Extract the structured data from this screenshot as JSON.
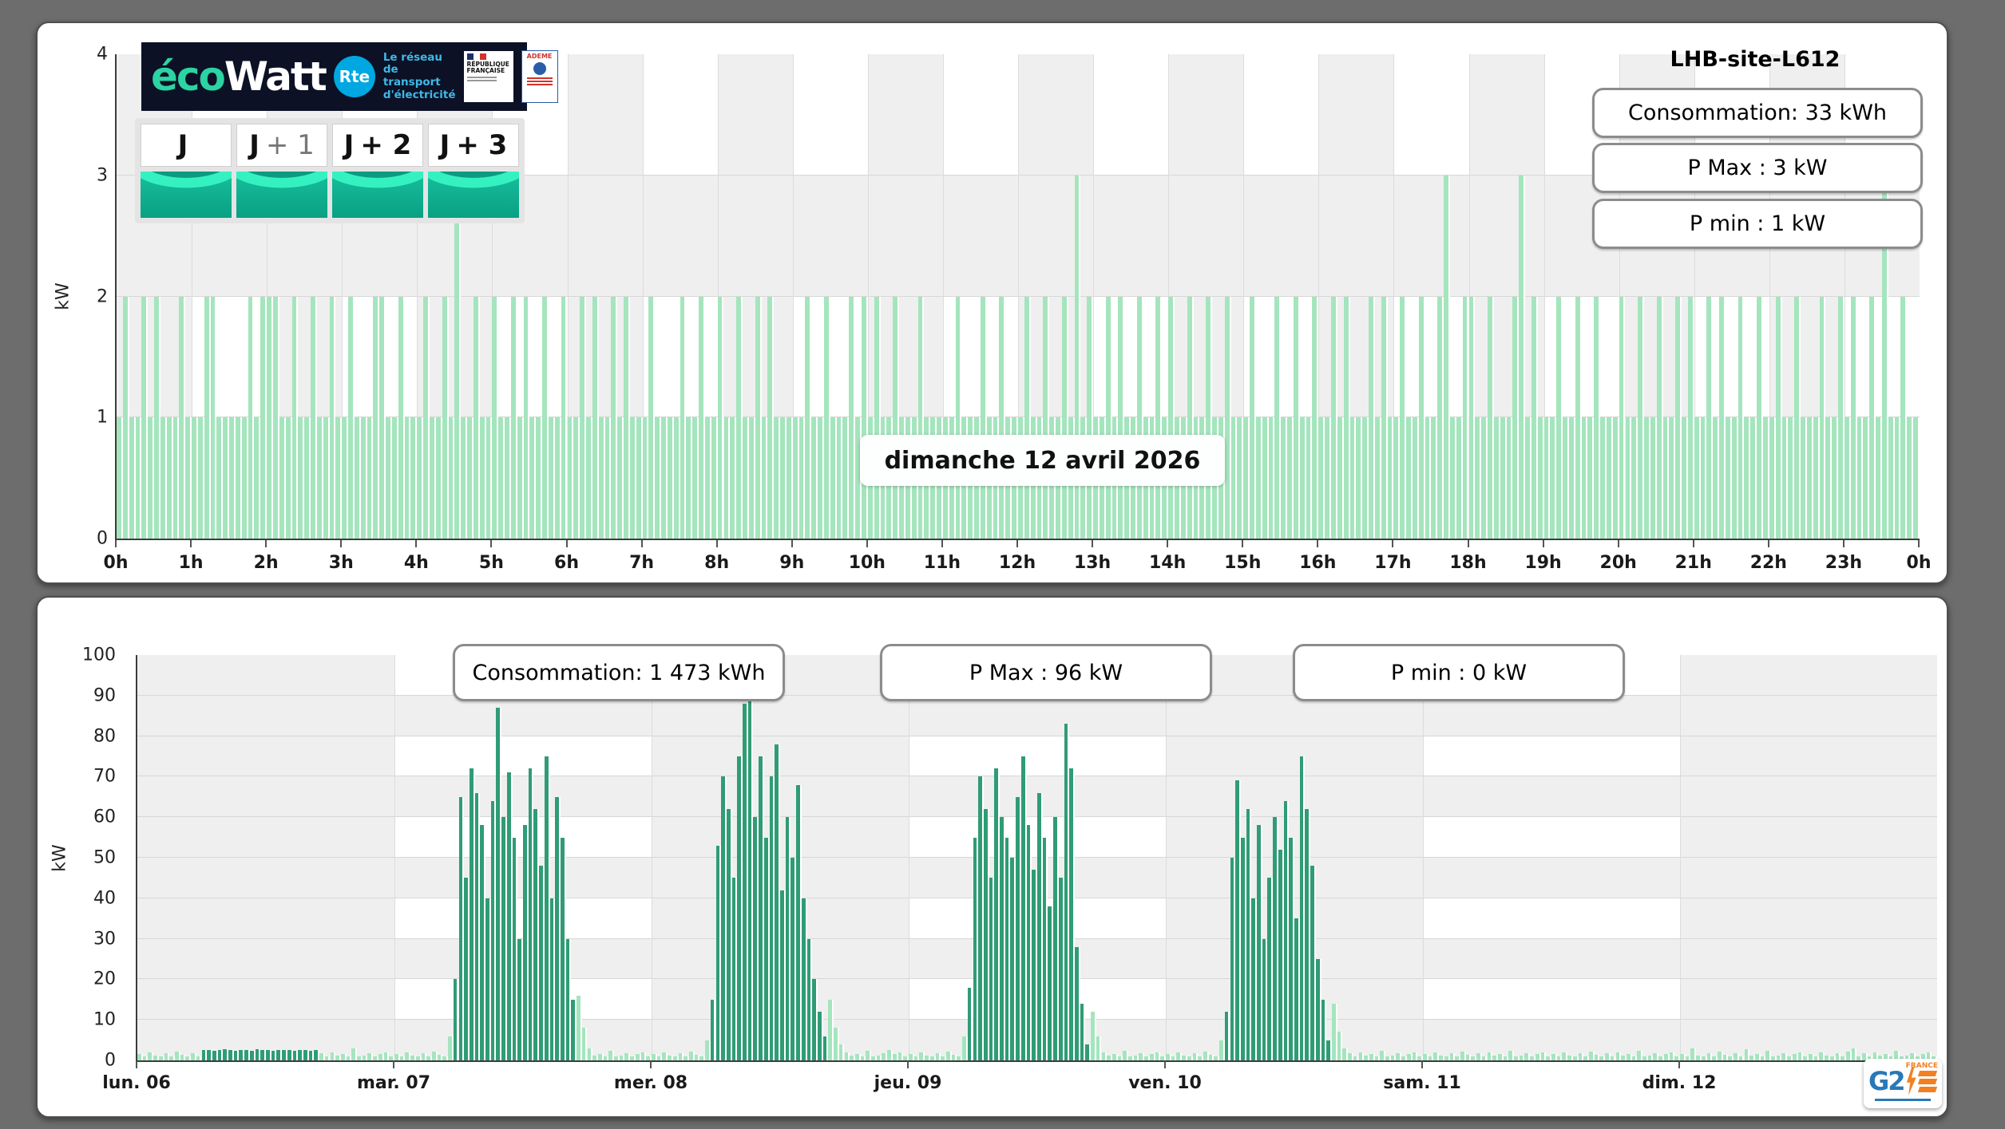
{
  "page": {
    "background": "#6d6d6d"
  },
  "branding": {
    "ecowatt": {
      "eco": "éco",
      "watt": "Watt",
      "rte_badge": "Rte",
      "rte_tagline_lines": [
        "Le réseau",
        "de transport",
        "d'électricité"
      ],
      "republique_line1": "RÉPUBLIQUE",
      "republique_line2": "FRANÇAISE",
      "ademe": "ADEME"
    },
    "g2e": {
      "g2": "G2",
      "france": "FRANCE"
    }
  },
  "tabs": [
    {
      "main": "J",
      "suffix": ""
    },
    {
      "main": "J",
      "suffix": "+ 1"
    },
    {
      "main": "J",
      "suffix": "+ 2"
    },
    {
      "main": "J",
      "suffix": "+ 3"
    }
  ],
  "colors": {
    "light_green": "#a4e5bd",
    "dark_green": "#2f9c75",
    "band_gray": "#efefef",
    "panel_border": "#4e4e4e"
  },
  "chart_data": [
    {
      "type": "bar",
      "title": "LHB-site-L612",
      "date_label": "dimanche 12 avril 2026",
      "ylabel": "kW",
      "ylim": [
        0,
        4
      ],
      "n_rows": 4,
      "n_columns": 24,
      "x_labels": [
        "0h",
        "1h",
        "2h",
        "3h",
        "4h",
        "5h",
        "6h",
        "7h",
        "8h",
        "9h",
        "10h",
        "11h",
        "12h",
        "13h",
        "14h",
        "15h",
        "16h",
        "17h",
        "18h",
        "19h",
        "20h",
        "21h",
        "22h",
        "23h",
        "0h"
      ],
      "y_labels": [
        "0",
        "1",
        "2",
        "3",
        "4"
      ],
      "stats": [
        {
          "label": "Consommation",
          "value": 33,
          "unit": "kWh",
          "text": "Consommation: 33 kWh"
        },
        {
          "label": "P Max",
          "value": 3,
          "unit": "kW",
          "text": "P Max :  3 kW"
        },
        {
          "label": "P min",
          "value": 1,
          "unit": "kW",
          "text": "P min : 1 kW"
        }
      ],
      "interval_minutes": 5,
      "values": [
        1,
        2,
        1,
        1,
        2,
        1,
        2,
        1,
        1,
        1,
        2,
        1,
        1,
        1,
        2,
        2,
        1,
        1,
        1,
        1,
        1,
        2,
        1,
        2,
        2,
        2,
        1,
        1,
        2,
        1,
        1,
        2,
        1,
        1,
        2,
        1,
        1,
        2,
        1,
        1,
        1,
        2,
        2,
        1,
        1,
        2,
        1,
        1,
        1,
        2,
        1,
        1,
        2,
        1,
        3,
        1,
        1,
        2,
        1,
        1,
        2,
        1,
        1,
        2,
        1,
        2,
        1,
        1,
        2,
        1,
        1,
        2,
        1,
        1,
        2,
        1,
        2,
        1,
        1,
        2,
        1,
        2,
        1,
        1,
        1,
        2,
        1,
        1,
        1,
        1,
        2,
        1,
        1,
        2,
        1,
        1,
        2,
        1,
        1,
        2,
        1,
        1,
        2,
        1,
        2,
        1,
        1,
        1,
        1,
        1,
        2,
        1,
        1,
        2,
        1,
        1,
        1,
        2,
        1,
        2,
        1,
        2,
        1,
        1,
        2,
        1,
        1,
        1,
        2,
        1,
        1,
        1,
        1,
        1,
        2,
        1,
        1,
        1,
        2,
        1,
        1,
        2,
        1,
        1,
        1,
        2,
        1,
        1,
        2,
        1,
        1,
        2,
        1,
        3,
        1,
        2,
        1,
        1,
        2,
        1,
        2,
        1,
        1,
        2,
        1,
        1,
        2,
        1,
        2,
        1,
        1,
        2,
        1,
        1,
        2,
        1,
        1,
        2,
        1,
        1,
        1,
        2,
        1,
        1,
        1,
        2,
        1,
        1,
        2,
        1,
        1,
        2,
        1,
        1,
        2,
        1,
        2,
        1,
        1,
        1,
        2,
        1,
        2,
        1,
        1,
        2,
        1,
        1,
        2,
        1,
        1,
        2,
        3,
        1,
        1,
        2,
        2,
        1,
        1,
        2,
        1,
        1,
        1,
        2,
        3,
        1,
        2,
        1,
        1,
        1,
        2,
        1,
        1,
        2,
        1,
        1,
        2,
        1,
        1,
        1,
        2,
        1,
        1,
        2,
        1,
        1,
        2,
        1,
        1,
        2,
        1,
        2,
        1,
        1,
        2,
        1,
        2,
        1,
        1,
        2,
        1,
        1,
        2,
        1,
        1,
        2,
        1,
        1,
        2,
        1,
        1,
        1,
        2,
        1,
        1,
        2,
        1,
        2,
        1,
        1,
        2,
        1,
        3,
        1,
        1,
        2,
        1,
        1
      ]
    },
    {
      "type": "bar",
      "ylabel": "kW",
      "ylim": [
        0,
        100
      ],
      "n_rows": 10,
      "n_columns": 7,
      "x_labels": [
        "lun. 06",
        "mar. 07",
        "mer. 08",
        "jeu. 09",
        "ven. 10",
        "sam. 11",
        "dim. 12"
      ],
      "y_labels": [
        "0",
        "10",
        "20",
        "30",
        "40",
        "50",
        "60",
        "70",
        "80",
        "90",
        "100"
      ],
      "stats": [
        {
          "label": "Consommation",
          "value": 1473,
          "unit": "kWh",
          "text": "Consommation: 1 473 kWh"
        },
        {
          "label": "P Max",
          "value": 96,
          "unit": "kW",
          "text": "P Max :  96 kW"
        },
        {
          "label": "P min",
          "value": 0,
          "unit": "kW",
          "text": "P min : 0 kW"
        }
      ],
      "interval_minutes": 30,
      "n_slots": 336,
      "base_series": {
        "name": "baseline",
        "pattern": [
          1.5,
          1,
          2,
          1.2,
          1,
          1.8,
          1,
          2.2,
          1.3,
          1,
          1.7,
          1,
          2,
          1.1,
          1.5,
          1,
          2.4,
          1,
          1.2,
          1.8,
          1,
          1.5,
          2,
          1
        ],
        "overrides": {
          "40": 3,
          "58": 6,
          "82": 16,
          "83": 8,
          "84": 3,
          "106": 5,
          "129": 15,
          "130": 8,
          "131": 4,
          "140": 2.6,
          "154": 6,
          "178": 12,
          "179": 6,
          "202": 5,
          "223": 14,
          "224": 7,
          "225": 3,
          "290": 3,
          "300": 2.8,
          "320": 3
        }
      },
      "process_series": {
        "name": "process",
        "segments": [
          {
            "start": 12,
            "values": [
              2.5,
              2.6,
              2.4,
              2.5,
              2.7,
              2.5,
              2.4,
              2.6,
              2.5,
              2.4,
              2.7,
              2.5,
              2.6,
              2.4,
              2.5,
              2.6,
              2.5,
              2.4,
              2.6,
              2.5,
              2.4,
              2.5
            ]
          },
          {
            "start": 59,
            "values": [
              20,
              65,
              45,
              72,
              66,
              58,
              40,
              64,
              87,
              60,
              71,
              55,
              30,
              58,
              72,
              62,
              48,
              75,
              40,
              65,
              55,
              30,
              15
            ]
          },
          {
            "start": 107,
            "values": [
              15,
              53,
              70,
              62,
              45,
              75,
              88,
              96,
              60,
              75,
              55,
              70,
              78,
              42,
              60,
              50,
              68,
              40,
              30,
              20,
              12,
              6
            ]
          },
          {
            "start": 155,
            "values": [
              18,
              55,
              70,
              62,
              45,
              72,
              60,
              55,
              50,
              65,
              75,
              58,
              47,
              66,
              55,
              38,
              60,
              45,
              83,
              72,
              28,
              14,
              4
            ]
          },
          {
            "start": 203,
            "values": [
              12,
              50,
              69,
              55,
              62,
              40,
              58,
              30,
              45,
              60,
              52,
              64,
              55,
              35,
              75,
              62,
              48,
              25,
              15,
              5
            ]
          }
        ]
      }
    }
  ]
}
